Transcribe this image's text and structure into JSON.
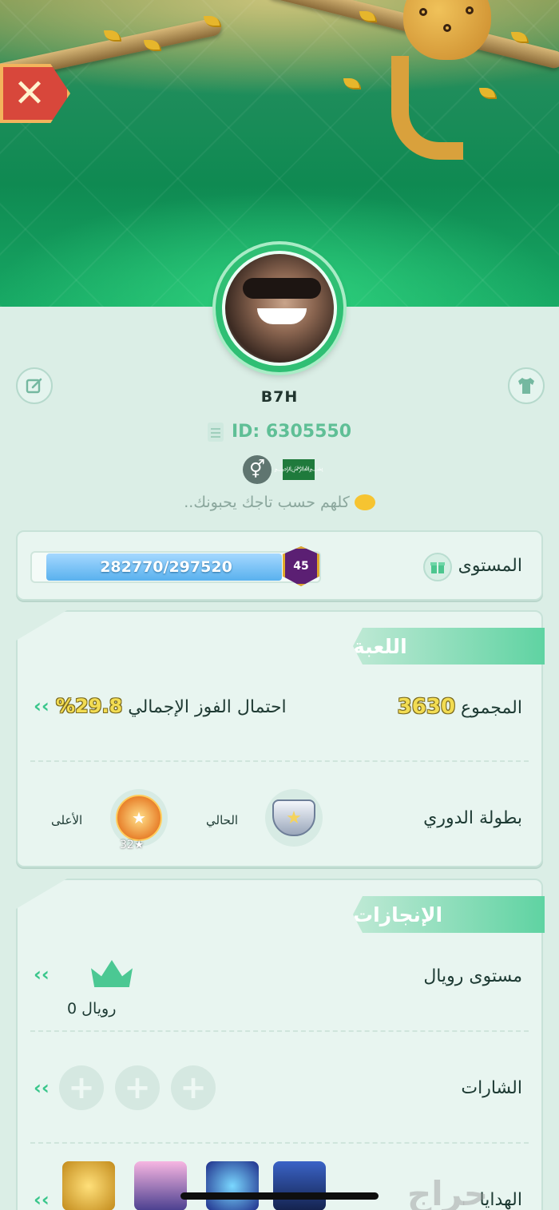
{
  "header": {
    "close_symbol": "✕"
  },
  "profile": {
    "username": "B7H",
    "id_text": "ID: 6305550",
    "gender_symbol": "⚥",
    "flag_text": "﷽",
    "bio": "كلهم حسب تاجك يحبونك.."
  },
  "level": {
    "label": "المستوى",
    "progress_text": "282770/297520",
    "current_xp": 282770,
    "next_xp": 297520,
    "level_number": "45"
  },
  "game": {
    "section_title": "اللعبة",
    "total_label": "المجموع",
    "total_value": "3630",
    "win_label": "احتمال الفوز الإجمالي",
    "win_value": "29.8%",
    "league_label": "بطولة الدوري",
    "current_label": "الحالي",
    "highest_label": "الأعلى",
    "highest_stars": "32★"
  },
  "achievements": {
    "section_title": "الإنجازات",
    "royal_label": "مستوى رويال",
    "royal_value": "رويال 0",
    "badges_label": "الشارات",
    "gifts_label": "الهدايا"
  },
  "icons": {
    "edit": "edit-icon",
    "shirt": "shirt-icon",
    "gift": "gift-icon",
    "chevron": "‹‹"
  },
  "watermark": "حراج",
  "colors": {
    "accent": "#3fcf92",
    "background": "#dbeee6",
    "progress": "#59b1ee"
  }
}
